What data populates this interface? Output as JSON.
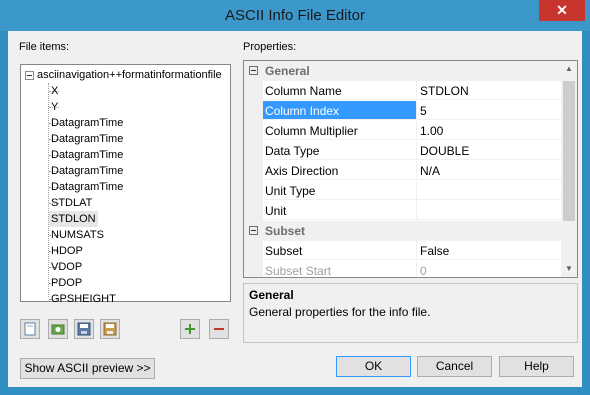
{
  "window": {
    "title": "ASCII Info File Editor",
    "close_glyph": "✕"
  },
  "file_items": {
    "label": "File items:",
    "root": "asciinavigation++formatinformationfile",
    "items": [
      "X",
      "Y",
      "DatagramTime",
      "DatagramTime",
      "DatagramTime",
      "DatagramTime",
      "DatagramTime",
      "STDLAT",
      "STDLON",
      "NUMSATS",
      "HDOP",
      "VDOP",
      "PDOP",
      "GPSHEIGHT"
    ],
    "selected_item": "STDLON",
    "toolbar_icons": [
      "new-file-icon",
      "open-file-icon",
      "save-icon",
      "save-as-icon",
      "add-icon",
      "remove-icon"
    ]
  },
  "properties": {
    "label": "Properties:",
    "categories": [
      {
        "name": "General",
        "rows": [
          {
            "name": "Column Name",
            "value": "STDLON"
          },
          {
            "name": "Column Index",
            "value": "5"
          },
          {
            "name": "Column Multiplier",
            "value": "1.00"
          },
          {
            "name": "Data Type",
            "value": "DOUBLE"
          },
          {
            "name": "Axis Direction",
            "value": "N/A"
          },
          {
            "name": "Unit Type",
            "value": ""
          },
          {
            "name": "Unit",
            "value": ""
          }
        ]
      },
      {
        "name": "Subset",
        "rows": [
          {
            "name": "Subset",
            "value": "False"
          },
          {
            "name": "Subset Start",
            "value": "0"
          }
        ]
      }
    ],
    "selected_row": "Column Index",
    "description": {
      "title": "General",
      "text": "General properties for the info file."
    }
  },
  "buttons": {
    "preview": "Show ASCII preview >>",
    "ok": "OK",
    "cancel": "Cancel",
    "help": "Help"
  },
  "colors": {
    "accent": "#3399ff",
    "title_bar": "#3c97cb",
    "close_button": "#c7352d",
    "add_icon": "#3f9a2b",
    "remove_icon": "#c0392b"
  }
}
